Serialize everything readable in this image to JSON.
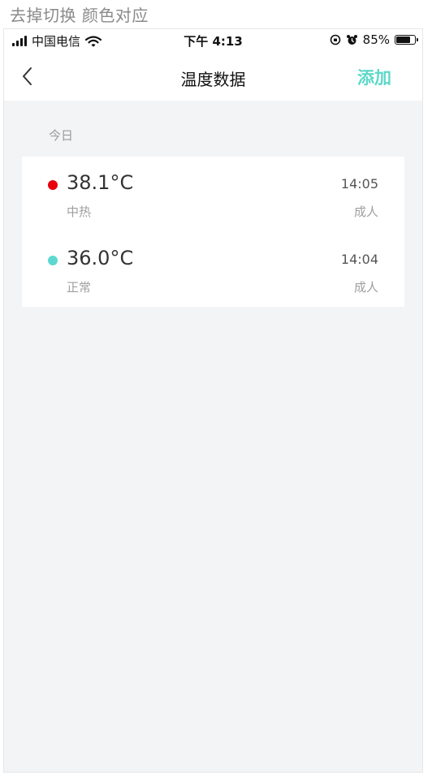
{
  "annotation": "去掉切换 颜色对应",
  "status_bar": {
    "carrier": "中国电信",
    "time": "下午 4:13",
    "battery_percent": "85%",
    "battery_level": 0.85
  },
  "nav": {
    "title": "温度数据",
    "add_label": "添加"
  },
  "section_label": "今日",
  "records": [
    {
      "temperature": "38.1°C",
      "status": "中热",
      "time": "14:05",
      "profile": "成人",
      "color": "#e8000b"
    },
    {
      "temperature": "36.0°C",
      "status": "正常",
      "time": "14:04",
      "profile": "成人",
      "color": "#5dd8d0"
    }
  ],
  "colors": {
    "accent": "#5dd8c9"
  }
}
